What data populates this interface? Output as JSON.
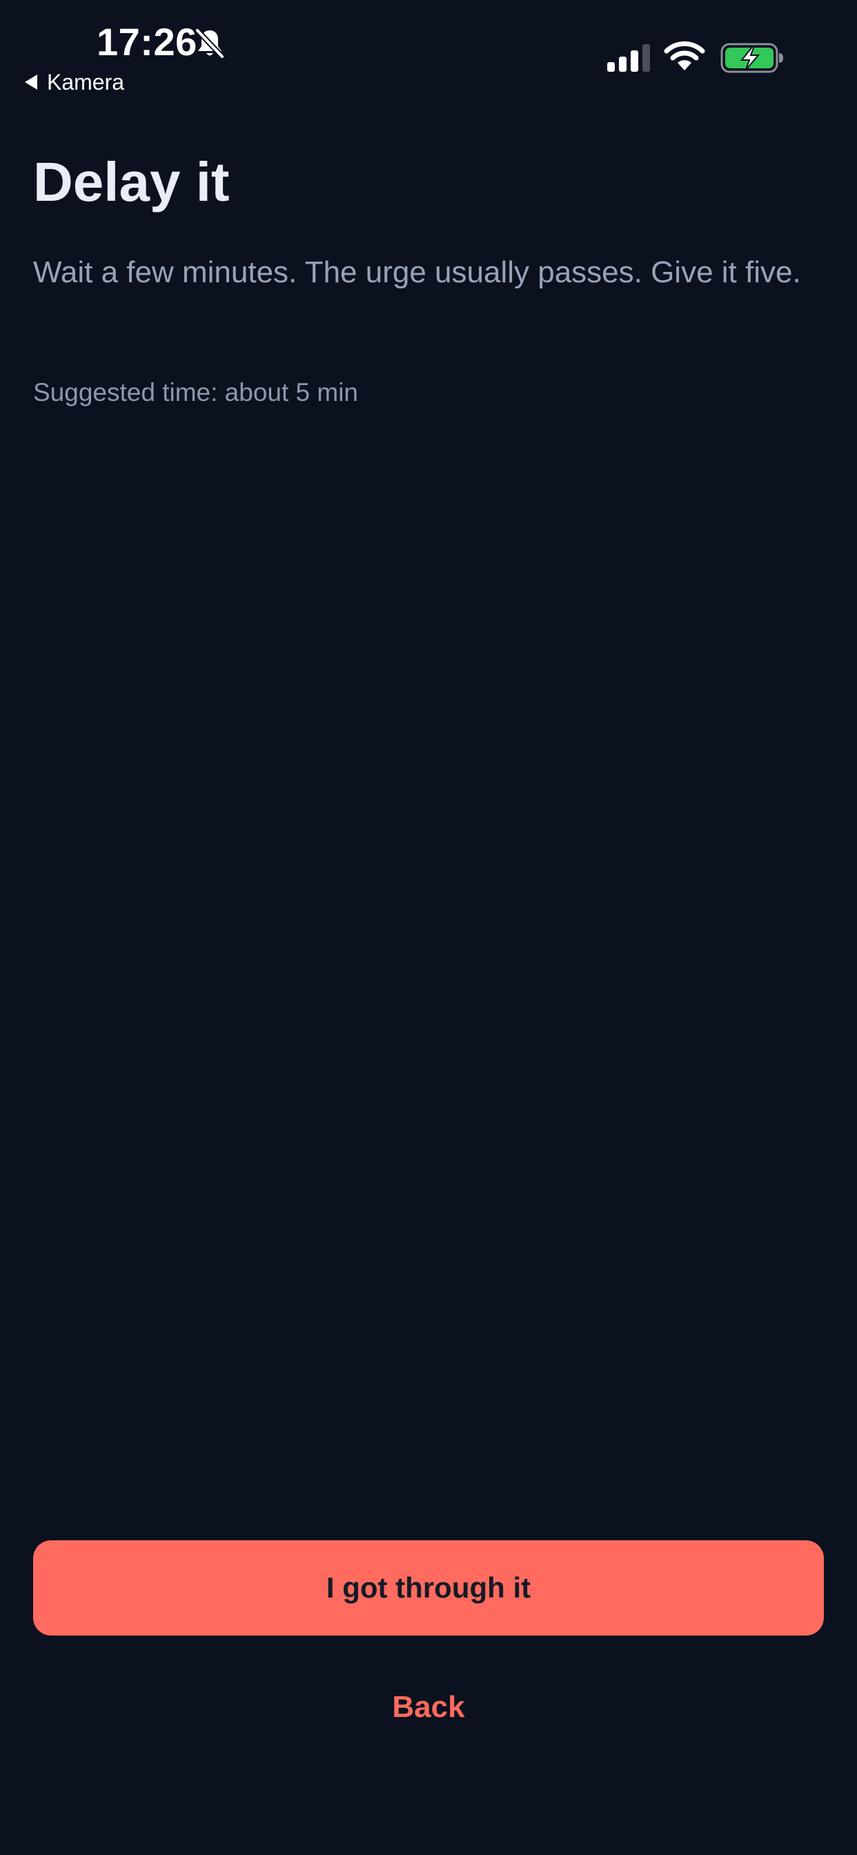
{
  "status_bar": {
    "time": "17:26",
    "back_app_label": "Kamera",
    "icons": [
      "bell-slash-icon",
      "cellular-signal-icon",
      "wifi-icon",
      "battery-charging-icon"
    ],
    "battery_color": "#34c759"
  },
  "screen": {
    "title": "Delay it",
    "description": "Wait a few minutes. The urge usually passes. Give it five.",
    "suggested_time": "Suggested time: about 5 min"
  },
  "actions": {
    "primary_label": "I got through it",
    "back_label": "Back"
  },
  "colors": {
    "background": "#0b111e",
    "accent": "#ff6b5e",
    "primary_text": "#e8edf8",
    "secondary_text": "#98a3b8"
  }
}
